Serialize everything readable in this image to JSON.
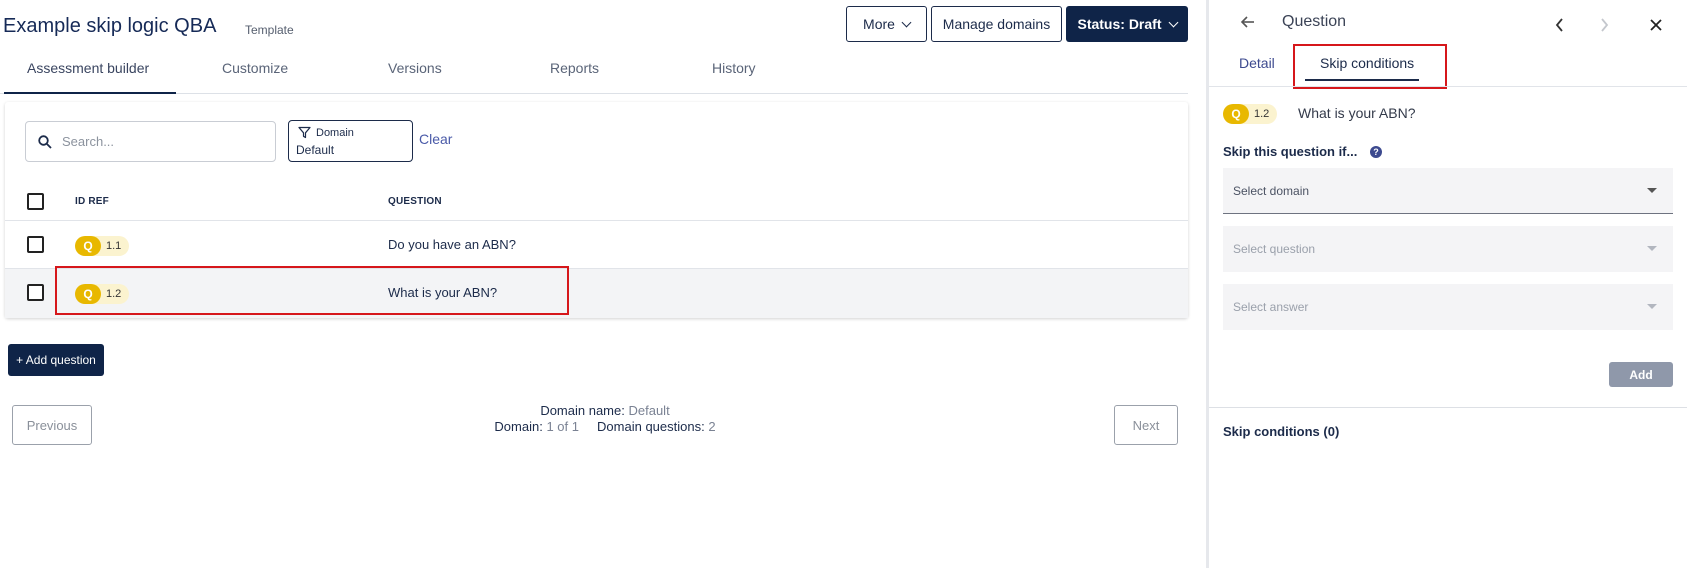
{
  "header": {
    "title": "Example skip logic QBA",
    "tag": "Template",
    "more_label": "More",
    "manage_domains_label": "Manage domains",
    "status_label": "Status: Draft"
  },
  "tabs": [
    "Assessment builder",
    "Customize",
    "Versions",
    "Reports",
    "History"
  ],
  "search": {
    "placeholder": "Search..."
  },
  "filter": {
    "label": "Domain",
    "value": "Default",
    "clear_label": "Clear"
  },
  "table": {
    "columns": [
      "ID REF",
      "QUESTION"
    ],
    "rows": [
      {
        "type": "Q",
        "id": "1.1",
        "question": "Do you have an ABN?"
      },
      {
        "type": "Q",
        "id": "1.2",
        "question": "What is your ABN?"
      }
    ]
  },
  "add_question_label": "+ Add question",
  "pagination": {
    "previous_label": "Previous",
    "next_label": "Next",
    "domain_name_label": "Domain name:",
    "domain_name_value": "Default",
    "domain_label": "Domain:",
    "domain_value": "1 of 1",
    "domain_questions_label": "Domain questions:",
    "domain_questions_value": "2"
  },
  "panel": {
    "title": "Question",
    "tabs": [
      "Detail",
      "Skip conditions"
    ],
    "question": {
      "type": "Q",
      "id": "1.2",
      "text": "What is your ABN?"
    },
    "skip_label": "Skip this question if...",
    "select_domain_placeholder": "Select domain",
    "select_question_placeholder": "Select question",
    "select_answer_placeholder": "Select answer",
    "add_label": "Add",
    "skip_conditions_count": "Skip conditions (0)"
  },
  "colors": {
    "navy": "#0f2448",
    "badge_yellow": "#e8b800",
    "highlight_red": "#d6171b",
    "link_blue": "#4a5aa8"
  },
  "icons": [
    "chevron-down-icon",
    "search-icon",
    "filter-icon",
    "back-arrow-icon",
    "chevron-left-icon",
    "chevron-right-icon",
    "close-icon",
    "help-icon",
    "caret-down-icon"
  ]
}
